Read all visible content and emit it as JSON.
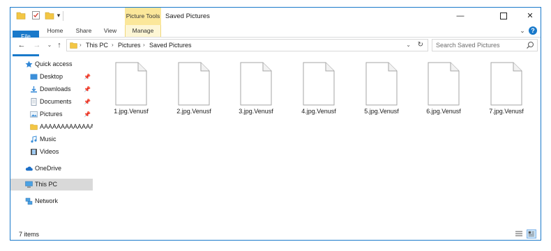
{
  "window": {
    "title": "Saved Pictures",
    "contextual_group": "Picture Tools",
    "controls": {
      "minimize": "—",
      "maximize": "",
      "close": "✕"
    }
  },
  "quick_access_toolbar": {
    "dropdown_glyph": "▾"
  },
  "ribbon": {
    "tabs": [
      {
        "label": "File"
      },
      {
        "label": "Home"
      },
      {
        "label": "Share"
      },
      {
        "label": "View"
      },
      {
        "label": "Manage"
      }
    ],
    "expand_glyph": "⌄",
    "help_glyph": "?"
  },
  "nav_buttons": {
    "back": "←",
    "forward": "→",
    "recent": "⌄",
    "up": "↑"
  },
  "address": {
    "crumbs": [
      "This PC",
      "Pictures",
      "Saved Pictures"
    ],
    "separator": "›",
    "dropdown_glyph": "⌄",
    "refresh_glyph": "↻"
  },
  "search": {
    "placeholder": "Search Saved Pictures"
  },
  "sidebar": {
    "items": [
      {
        "label": "Quick access",
        "icon": "star-icon",
        "pinned": false
      },
      {
        "label": "Desktop",
        "icon": "desktop-icon",
        "pinned": true
      },
      {
        "label": "Downloads",
        "icon": "downloads-icon",
        "pinned": true
      },
      {
        "label": "Documents",
        "icon": "documents-icon",
        "pinned": true
      },
      {
        "label": "Pictures",
        "icon": "pictures-icon",
        "pinned": true
      },
      {
        "label": "AAAAAAAAAAAAAA",
        "icon": "folder-icon",
        "pinned": false
      },
      {
        "label": "Music",
        "icon": "music-icon",
        "pinned": false
      },
      {
        "label": "Videos",
        "icon": "videos-icon",
        "pinned": false
      },
      {
        "label": "OneDrive",
        "icon": "cloud-icon",
        "pinned": false
      },
      {
        "label": "This PC",
        "icon": "computer-icon",
        "pinned": false,
        "selected": true
      },
      {
        "label": "Network",
        "icon": "network-icon",
        "pinned": false
      }
    ],
    "pin_glyph": "📌"
  },
  "files": [
    {
      "name": "1.jpg.Venusf"
    },
    {
      "name": "2.jpg.Venusf"
    },
    {
      "name": "3.jpg.Venusf"
    },
    {
      "name": "4.jpg.Venusf"
    },
    {
      "name": "5.jpg.Venusf"
    },
    {
      "name": "6.jpg.Venusf"
    },
    {
      "name": "7.jpg.Venusf"
    }
  ],
  "status": {
    "item_count": "7 items"
  },
  "colors": {
    "accent": "#1979ca",
    "picture_tools": "#fbe79a",
    "selected_nav": "#d9d9d9",
    "folder": "#f3c644"
  }
}
